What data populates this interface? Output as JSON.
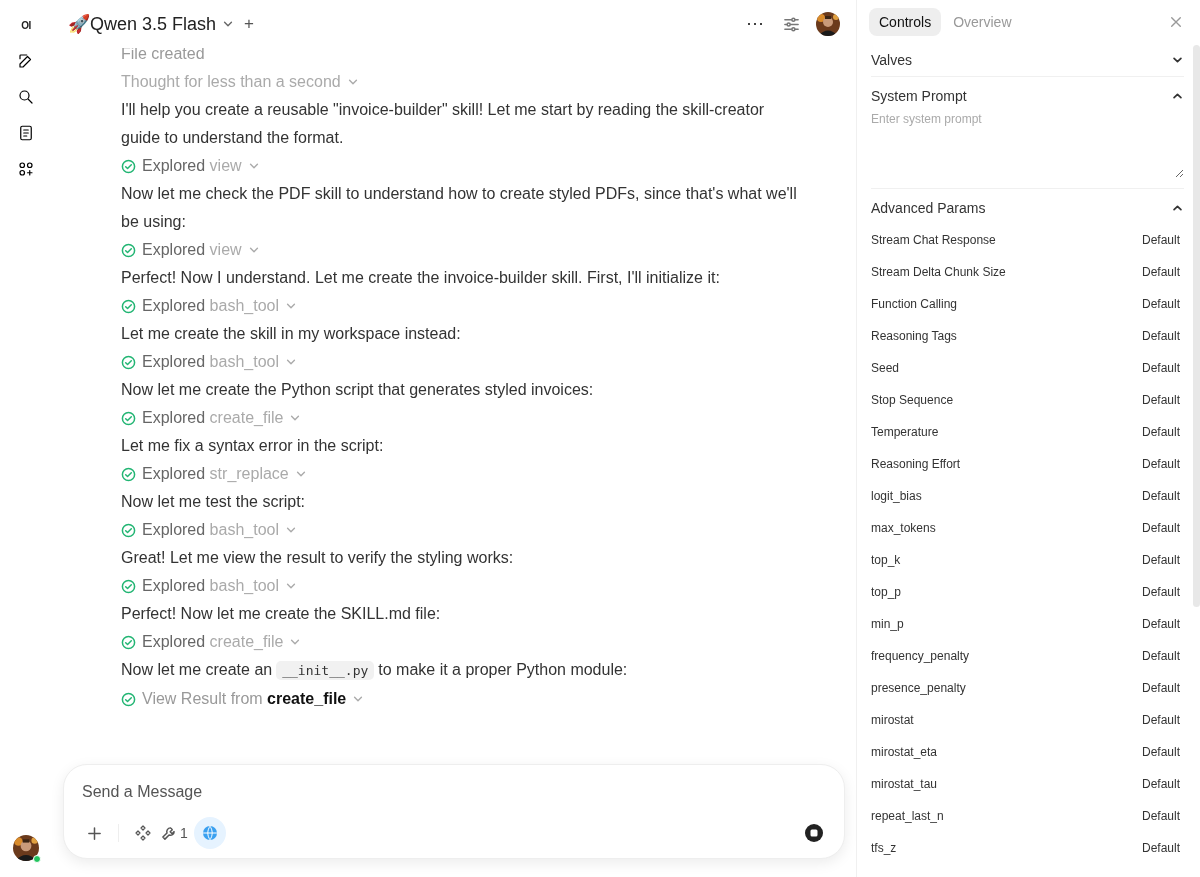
{
  "sidebar": {
    "logo": "OI",
    "user": {
      "online": true
    }
  },
  "header": {
    "model": "🚀Qwen 3.5 Flash",
    "add_label": "+"
  },
  "messages": [
    {
      "kind": "status",
      "text": "File created"
    },
    {
      "kind": "thought",
      "text": "Thought for less than a second"
    },
    {
      "kind": "text",
      "text": "I'll help you create a reusable \"invoice-builder\" skill! Let me start by reading the skill-creator guide to understand the format."
    },
    {
      "kind": "tool",
      "action": "Explored",
      "target": "view",
      "done": true
    },
    {
      "kind": "text",
      "text": "Now let me check the PDF skill to understand how to create styled PDFs, since that's what we'll be using:"
    },
    {
      "kind": "tool",
      "action": "Explored",
      "target": "view",
      "done": true
    },
    {
      "kind": "text",
      "text": "Perfect! Now I understand. Let me create the invoice-builder skill. First, I'll initialize it:"
    },
    {
      "kind": "tool",
      "action": "Explored",
      "target": "bash_tool",
      "done": true
    },
    {
      "kind": "text",
      "text": "Let me create the skill in my workspace instead:"
    },
    {
      "kind": "tool",
      "action": "Explored",
      "target": "bash_tool",
      "done": true
    },
    {
      "kind": "text",
      "text": "Now let me create the Python script that generates styled invoices:"
    },
    {
      "kind": "tool",
      "action": "Explored",
      "target": "create_file",
      "done": true
    },
    {
      "kind": "text",
      "text": "Let me fix a syntax error in the script:"
    },
    {
      "kind": "tool",
      "action": "Explored",
      "target": "str_replace",
      "done": true
    },
    {
      "kind": "text",
      "text": "Now let me test the script:"
    },
    {
      "kind": "tool",
      "action": "Explored",
      "target": "bash_tool",
      "done": true
    },
    {
      "kind": "text",
      "text": "Great! Let me view the result to verify the styling works:"
    },
    {
      "kind": "tool",
      "action": "Explored",
      "target": "bash_tool",
      "done": true
    },
    {
      "kind": "text",
      "text": "Perfect! Now let me create the SKILL.md file:"
    },
    {
      "kind": "tool",
      "action": "Explored",
      "target": "create_file",
      "done": true
    },
    {
      "kind": "code_text",
      "before": "Now let me create an",
      "code": "__init__.py",
      "after": "to make it a proper Python module:"
    },
    {
      "kind": "result",
      "action": "View Result from",
      "target": "create_file",
      "done": true
    }
  ],
  "composer": {
    "placeholder": "Send a Message",
    "tool_count": "1",
    "web_search": true
  },
  "panel": {
    "tabs": [
      {
        "label": "Controls",
        "selected": true
      },
      {
        "label": "Overview",
        "selected": false
      }
    ],
    "sections": [
      {
        "kind": "valves",
        "title": "Valves",
        "expanded": false
      },
      {
        "kind": "prompt",
        "title": "System Prompt",
        "expanded": true,
        "placeholder": "Enter system prompt"
      },
      {
        "kind": "params",
        "title": "Advanced Params",
        "expanded": true,
        "params": [
          {
            "name": "Stream Chat Response",
            "value": "Default"
          },
          {
            "name": "Stream Delta Chunk Size",
            "value": "Default"
          },
          {
            "name": "Function Calling",
            "value": "Default"
          },
          {
            "name": "Reasoning Tags",
            "value": "Default"
          },
          {
            "name": "Seed",
            "value": "Default"
          },
          {
            "name": "Stop Sequence",
            "value": "Default"
          },
          {
            "name": "Temperature",
            "value": "Default"
          },
          {
            "name": "Reasoning Effort",
            "value": "Default"
          },
          {
            "name": "logit_bias",
            "value": "Default"
          },
          {
            "name": "max_tokens",
            "value": "Default"
          },
          {
            "name": "top_k",
            "value": "Default"
          },
          {
            "name": "top_p",
            "value": "Default"
          },
          {
            "name": "min_p",
            "value": "Default"
          },
          {
            "name": "frequency_penalty",
            "value": "Default"
          },
          {
            "name": "presence_penalty",
            "value": "Default"
          },
          {
            "name": "mirostat",
            "value": "Default"
          },
          {
            "name": "mirostat_eta",
            "value": "Default"
          },
          {
            "name": "mirostat_tau",
            "value": "Default"
          },
          {
            "name": "repeat_last_n",
            "value": "Default"
          },
          {
            "name": "tfs_z",
            "value": "Default"
          }
        ]
      }
    ]
  }
}
